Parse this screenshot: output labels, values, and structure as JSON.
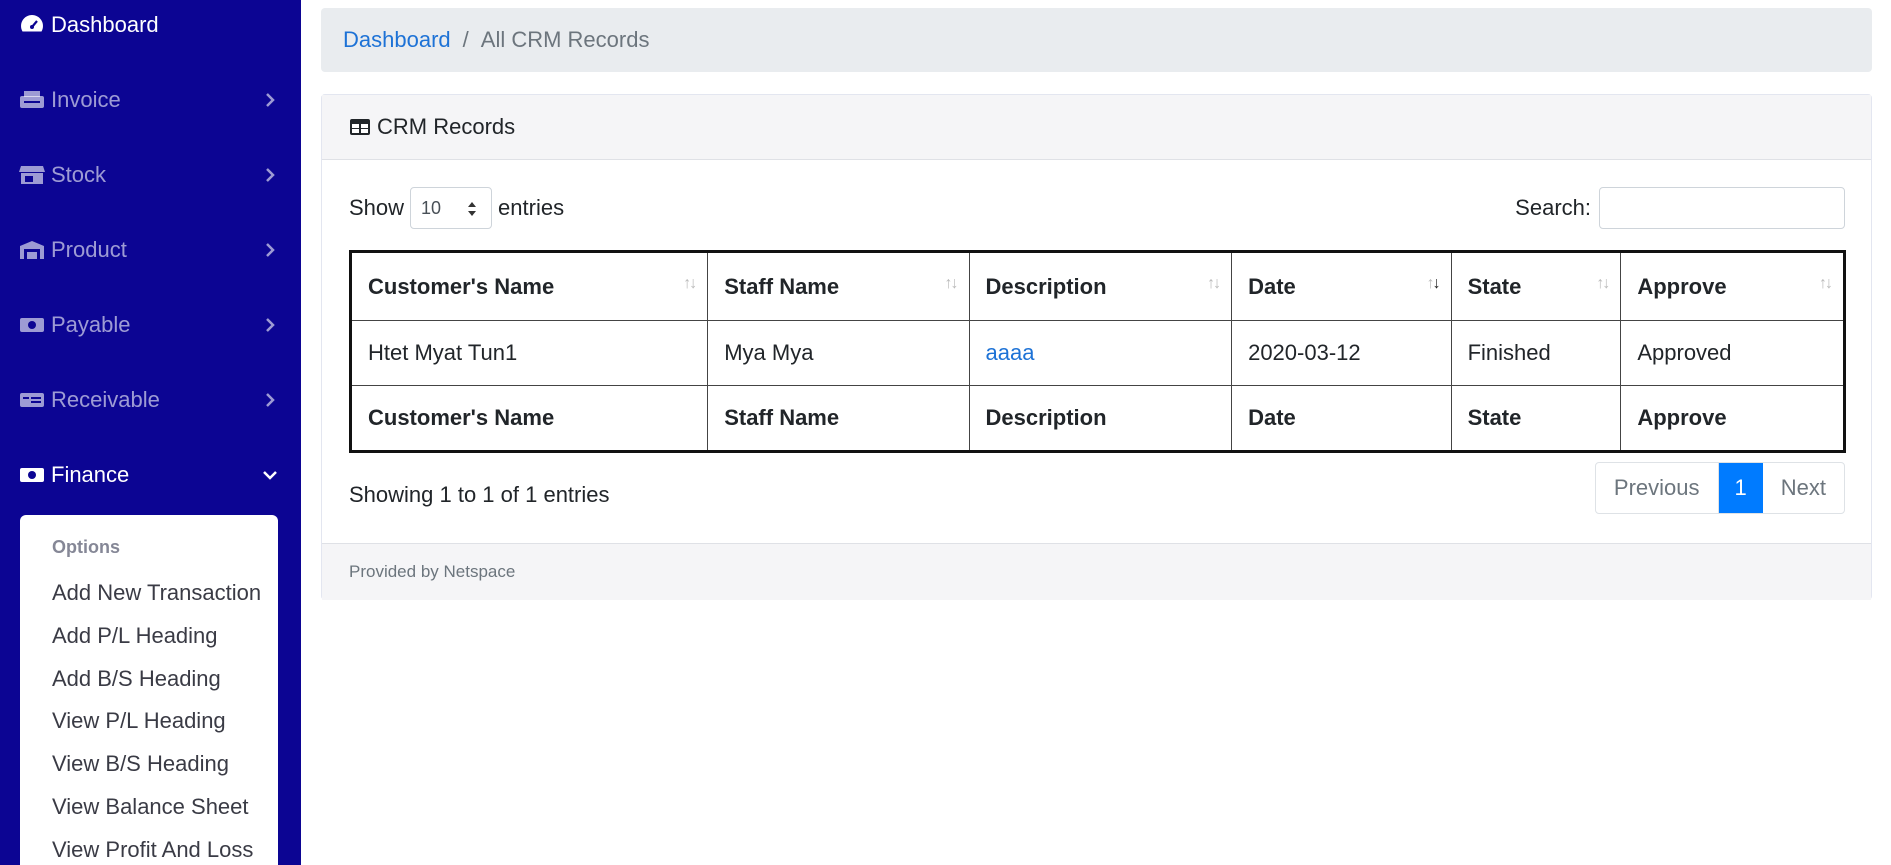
{
  "sidebar": {
    "items": [
      {
        "label": "Dashboard",
        "icon": "tachometer-icon"
      },
      {
        "label": "Invoice",
        "icon": "printer-icon"
      },
      {
        "label": "Stock",
        "icon": "store-icon"
      },
      {
        "label": "Product",
        "icon": "warehouse-icon"
      },
      {
        "label": "Payable",
        "icon": "money-bill-icon"
      },
      {
        "label": "Receivable",
        "icon": "money-check-icon"
      },
      {
        "label": "Finance",
        "icon": "money-bill-wave-icon"
      }
    ],
    "submenu": {
      "header": "Options",
      "items": [
        "Add New Transaction",
        "Add P/L Heading",
        "Add B/S Heading",
        "View P/L Heading",
        "View B/S Heading",
        "View Balance Sheet",
        "View Profit And Loss"
      ]
    }
  },
  "breadcrumb": {
    "home": "Dashboard",
    "separator": "/",
    "current": "All CRM Records"
  },
  "card": {
    "title": "CRM Records",
    "footer": "Provided by Netspace"
  },
  "controls": {
    "show_label": "Show",
    "entries_label": "entries",
    "page_length": "10",
    "search_label": "Search:",
    "search_value": ""
  },
  "table": {
    "headers": [
      "Customer's Name",
      "Staff Name",
      "Description",
      "Date",
      "State",
      "Approve"
    ],
    "rows": [
      [
        "Htet Myat Tun1",
        "Mya Mya",
        "aaaa",
        "2020-03-12",
        "Finished",
        "Approved"
      ]
    ],
    "sorted_column": "Date"
  },
  "pagination": {
    "info": "Showing 1 to 1 of 1 entries",
    "previous": "Previous",
    "current": "1",
    "next": "Next"
  },
  "colors": {
    "sidebar": "#0c0593",
    "link": "#1d72d6",
    "active_page": "#007bff"
  }
}
